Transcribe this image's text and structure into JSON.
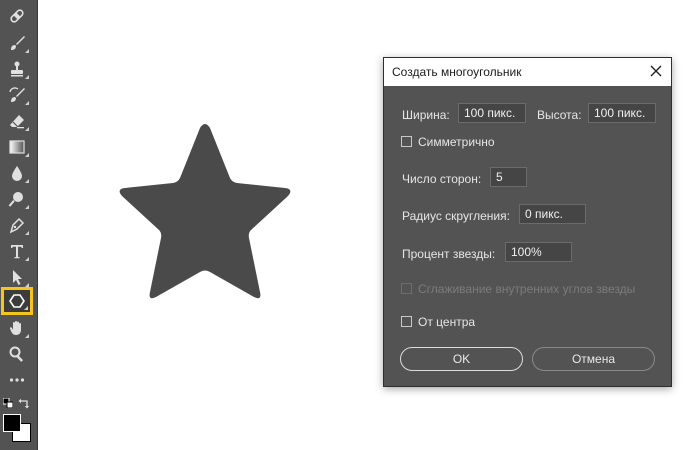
{
  "toolbar": {
    "tools": [
      {
        "icon": "healing-brush-icon"
      },
      {
        "icon": "brush-icon"
      },
      {
        "icon": "clone-stamp-icon"
      },
      {
        "icon": "history-brush-icon"
      },
      {
        "icon": "eraser-icon"
      },
      {
        "icon": "gradient-icon"
      },
      {
        "icon": "blur-icon"
      },
      {
        "icon": "dodge-icon"
      },
      {
        "icon": "pen-icon"
      },
      {
        "icon": "type-icon",
        "glyph": "T"
      },
      {
        "icon": "path-selection-icon"
      },
      {
        "icon": "polygon-icon",
        "selected": true
      },
      {
        "icon": "hand-icon"
      },
      {
        "icon": "zoom-icon"
      },
      {
        "icon": "more-icon",
        "glyph": "•••"
      }
    ],
    "colors": {
      "foreground": "#000000",
      "background": "#ffffff",
      "highlight": "#f5c519"
    }
  },
  "canvas": {
    "star_color": "#4a4a4a"
  },
  "dialog": {
    "title": "Создать многоугольник",
    "width_label": "Ширина:",
    "width_value": "100 пикс.",
    "height_label": "Высота:",
    "height_value": "100 пикс.",
    "symmetric_label": "Симметрично",
    "symmetric_checked": false,
    "sides_label": "Число сторон:",
    "sides_value": "5",
    "corner_radius_label": "Радиус скругления:",
    "corner_radius_value": "0 пикс.",
    "star_ratio_label": "Процент звезды:",
    "star_ratio_value": "100%",
    "smooth_indents_label": "Сглаживание внутренних углов звезды",
    "smooth_indents_enabled": false,
    "from_center_label": "От центра",
    "from_center_checked": false,
    "ok_label": "OK",
    "cancel_label": "Отмена"
  }
}
